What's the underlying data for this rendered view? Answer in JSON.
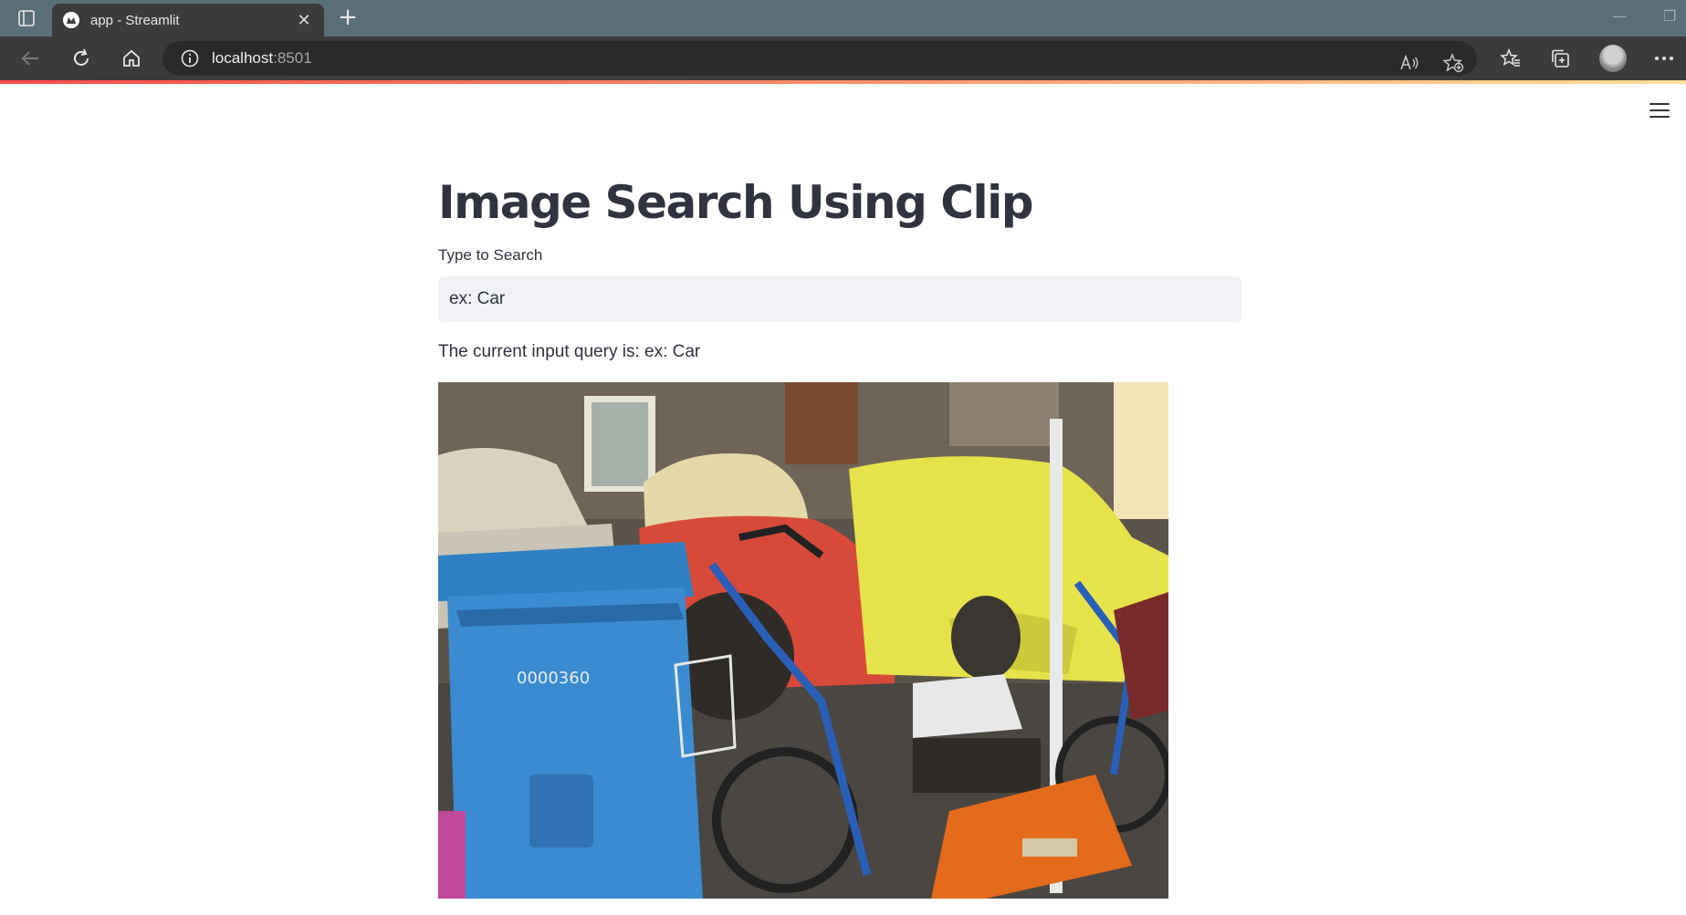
{
  "browser": {
    "tab_title": "app - Streamlit",
    "address_host": "localhost",
    "address_port": ":8501"
  },
  "app": {
    "title": "Image Search Using Clip",
    "input_label": "Type to Search",
    "input_value": "ex: Car",
    "query_text": "The current input query is: ex: Car",
    "result_image_label": "0000360"
  },
  "colors": {
    "accent": "#ff4b4b",
    "text": "#31333f",
    "input_bg": "#f0f2f6"
  }
}
